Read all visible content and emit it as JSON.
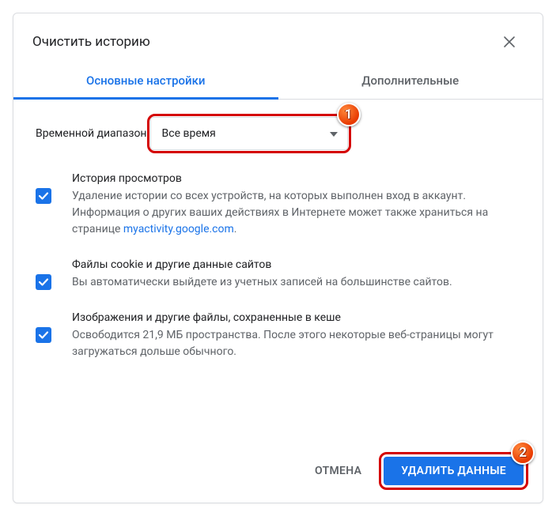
{
  "dialog": {
    "title": "Очистить историю"
  },
  "tabs": {
    "basic": "Основные настройки",
    "advanced": "Дополнительные"
  },
  "range": {
    "label": "Временной диапазон",
    "selected": "Все время"
  },
  "options": {
    "history": {
      "title": "История просмотров",
      "desc_pre": "Удаление истории со всех устройств, на которых выполнен вход в аккаунт. Информация о других ваших действиях в Интернете может также храниться на странице ",
      "link": "myactivity.google.com",
      "desc_post": "."
    },
    "cookies": {
      "title": "Файлы cookie и другие данные сайтов",
      "desc": "Вы автоматически выйдете из учетных записей на большинстве сайтов."
    },
    "cache": {
      "title": "Изображения и другие файлы, сохраненные в кеше",
      "desc": "Освободится 21,9 МБ пространства. После этого некоторые веб-страницы могут загружаться дольше обычного."
    }
  },
  "buttons": {
    "cancel": "ОТМЕНА",
    "delete": "УДАЛИТЬ ДАННЫЕ"
  },
  "callouts": {
    "one": "1",
    "two": "2"
  }
}
